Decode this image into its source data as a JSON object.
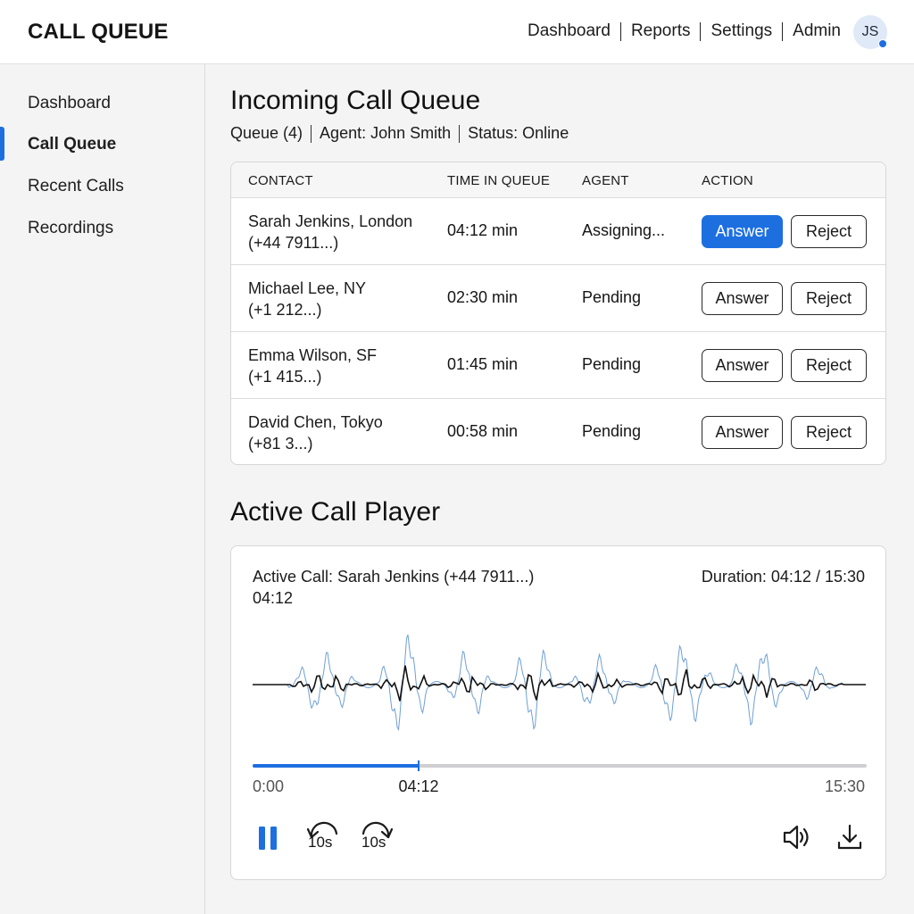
{
  "header": {
    "title": "CALL QUEUE",
    "nav": [
      "Dashboard",
      "Reports",
      "Settings",
      "Admin"
    ],
    "avatar_initials": "JS",
    "status_dot_color": "#1d6fe0"
  },
  "sidebar": {
    "items": [
      {
        "label": "Dashboard",
        "active": false
      },
      {
        "label": "Call Queue",
        "active": true
      },
      {
        "label": "Recent Calls",
        "active": false
      },
      {
        "label": "Recordings",
        "active": false
      }
    ]
  },
  "queue": {
    "title": "Incoming Call Queue",
    "meta": {
      "count": "Queue (4)",
      "agent": "Agent: John Smith",
      "status": "Status: Online"
    },
    "columns": [
      "CONTACT",
      "TIME IN QUEUE",
      "AGENT",
      "ACTION"
    ],
    "rows": [
      {
        "name": "Sarah Jenkins, London",
        "phone": "(+44 7911...)",
        "time": "04:12 min",
        "agent": "Assigning...",
        "answer": "Answer",
        "reject": "Reject",
        "answer_primary": true
      },
      {
        "name": "Michael Lee, NY",
        "phone": "(+1 212...)",
        "time": "02:30 min",
        "agent": "Pending",
        "answer": "Answer",
        "reject": "Reject",
        "answer_primary": false
      },
      {
        "name": "Emma Wilson, SF",
        "phone": "(+1 415...)",
        "time": "01:45 min",
        "agent": "Pending",
        "answer": "Answer",
        "reject": "Reject",
        "answer_primary": false
      },
      {
        "name": "David Chen, Tokyo",
        "phone": "(+81 3...)",
        "time": "00:58 min",
        "agent": "Pending",
        "answer": "Answer",
        "reject": "Reject",
        "answer_primary": false
      }
    ]
  },
  "player": {
    "title": "Active Call Player",
    "call_label": "Active Call: Sarah Jenkins (+44 7911...)",
    "current_time": "04:12",
    "duration": "Duration: 04:12 / 15:30",
    "time_start": "0:00",
    "time_current": "04:12",
    "time_end": "15:30",
    "progress": 0.271,
    "skip_back_label": "10s",
    "skip_forward_label": "10s",
    "icons": {
      "play_pause": "pause-icon",
      "rewind": "rewind-10s-icon",
      "forward": "forward-10s-icon",
      "volume": "volume-icon",
      "download": "download-icon"
    },
    "accent_color": "#1d6fe0",
    "waveform_color": "#6e9fd6",
    "voice_line_color": "#111111"
  }
}
